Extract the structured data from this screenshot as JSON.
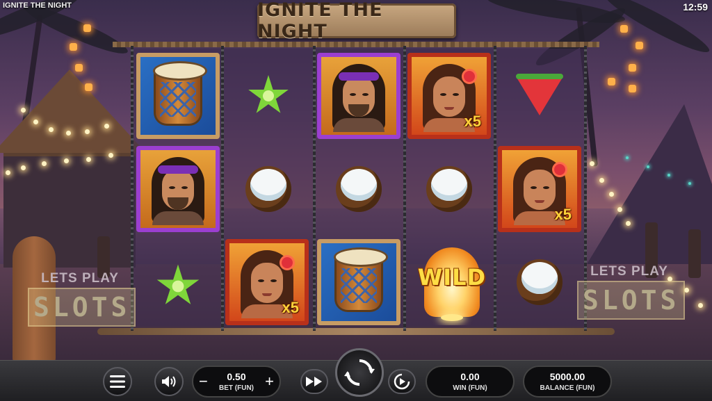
{
  "game": {
    "title": "IGNITE THE NIGHT",
    "logo_text": "IGNITE THE NIGHT",
    "clock": "12:59"
  },
  "reels": [
    [
      {
        "symbol": "drum",
        "icon": "drum-icon"
      },
      {
        "symbol": "man",
        "icon": "man-icon"
      },
      {
        "symbol": "empty"
      }
    ],
    [
      {
        "symbol": "starfruit",
        "icon": "starfruit-icon"
      },
      {
        "symbol": "coconut",
        "icon": "coconut-icon"
      },
      {
        "symbol": "woman",
        "icon": "woman-icon",
        "multiplier": "x5"
      }
    ],
    [
      {
        "symbol": "man",
        "icon": "man-icon"
      },
      {
        "symbol": "coconut",
        "icon": "coconut-icon"
      },
      {
        "symbol": "drum",
        "icon": "drum-icon"
      }
    ],
    [
      {
        "symbol": "woman",
        "icon": "woman-icon",
        "multiplier": "x5"
      },
      {
        "symbol": "coconut",
        "icon": "coconut-icon"
      },
      {
        "symbol": "wild",
        "icon": "wild-lantern-icon",
        "label": "WILD"
      }
    ],
    [
      {
        "symbol": "watermelon",
        "icon": "watermelon-icon"
      },
      {
        "symbol": "woman",
        "icon": "woman-icon",
        "multiplier": "x5"
      },
      {
        "symbol": "coconut",
        "icon": "coconut-icon"
      }
    ]
  ],
  "first_reel_extra": {
    "symbol": "starfruit",
    "icon": "starfruit-icon"
  },
  "signs": {
    "left": {
      "top": "LETS PLAY",
      "bottom": "SLOTS"
    },
    "right": {
      "top": "LETS PLAY",
      "bottom": "SLOTS"
    }
  },
  "controls": {
    "menu_icon": "hamburger-icon",
    "sound_icon": "speaker-icon",
    "bet_value": "0.50",
    "bet_label": "BET (FUN)",
    "bet_minus": "−",
    "bet_plus": "+",
    "fast_icon": "fast-forward-icon",
    "spin_icon": "spin-icon",
    "autoplay_icon": "autoplay-icon",
    "win_value": "0.00",
    "win_label": "WIN (FUN)",
    "balance_value": "5000.00",
    "balance_label": "BALANCE (FUN)"
  },
  "colors": {
    "bar": "#1f1f22",
    "accent_gold": "#ffd23a",
    "wild": "#ffdd45"
  }
}
